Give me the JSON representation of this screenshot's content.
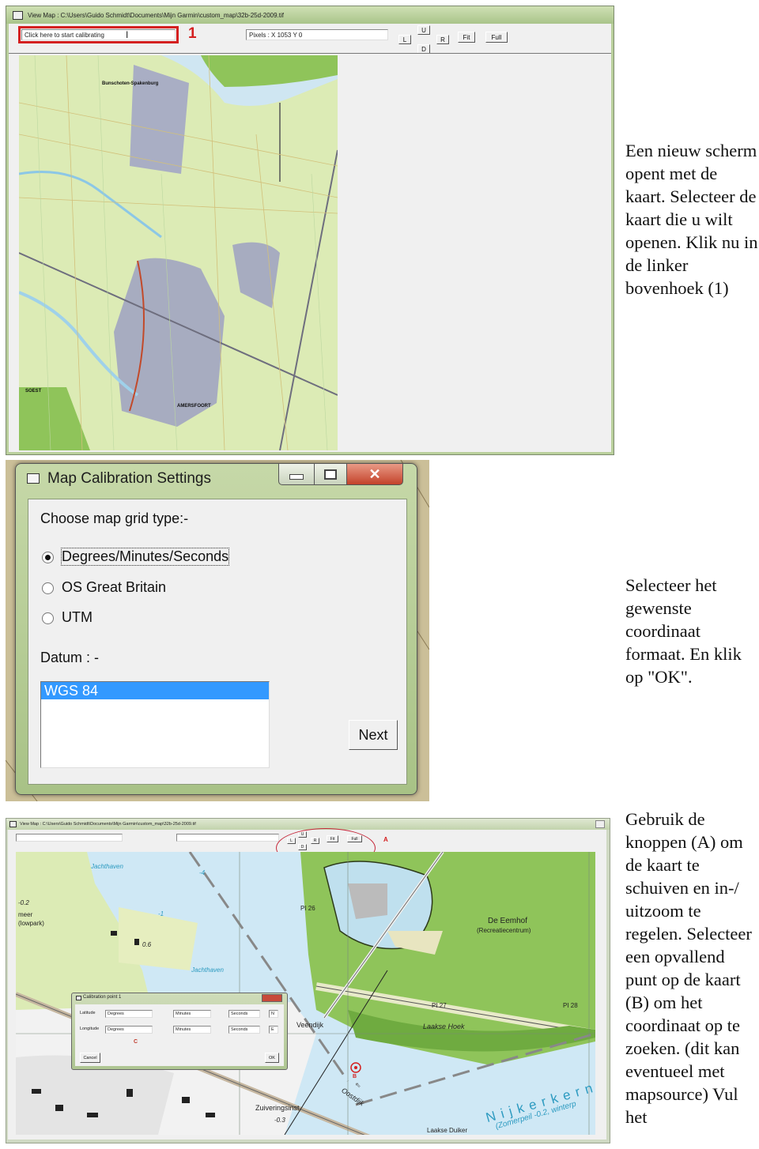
{
  "step1": {
    "window_title": "View Map : C:\\Users\\Guido Schmidt\\Documents\\Mijn Garmin\\custom_map\\32b-25d-2009.tif",
    "calibrate_field_value": "Click here to start calibrating",
    "annotation_marker": "1",
    "pixels_readout": "Pixels : X 1053 Y 0",
    "nav_buttons": {
      "left": "L",
      "up": "U",
      "right": "R",
      "down": "D",
      "fit": "Fit",
      "full": "Full"
    },
    "map_labels": [
      "Bunschoten-Spakenburg",
      "SOEST",
      "AMERSFOORT"
    ],
    "caption": "Een nieuw scherm opent met de kaart. Selecteer de kaart die u wilt openen. Klik nu in de linker bovenhoek (1)"
  },
  "step2": {
    "dialog_title": "Map Calibration Settings",
    "grid_type_label": "Choose map grid type:-",
    "grid_options": [
      {
        "label": "Degrees/Minutes/Seconds",
        "selected": true
      },
      {
        "label": "OS Great Britain",
        "selected": false
      },
      {
        "label": "UTM",
        "selected": false
      }
    ],
    "datum_label": "Datum : -",
    "datum_options": [
      {
        "label": "WGS 84",
        "selected": true
      }
    ],
    "next_button": "Next",
    "caption": "Selecteer het gewenste coordinaat formaat. En klik op \"OK\"."
  },
  "step3": {
    "window_title": "View Map : C:\\Users\\Guido Schmidt\\Documents\\Mijn Garmin\\custom_map\\32b-25d-2009.tif",
    "nav_buttons": {
      "left": "L",
      "up": "U",
      "right": "R",
      "down": "D",
      "fit": "Fit",
      "full": "Full"
    },
    "annotation_a": "A",
    "annotation_b": "B",
    "annotation_c": "C",
    "map_labels": [
      "Jachthaven",
      "-4",
      "-1",
      "0.6",
      "-0.2",
      "meer",
      "(lowpark)",
      "Jachthaven",
      "PI 26",
      "De Eemhof",
      "(Recreatiecentrum)",
      "PI 27",
      "PI 28",
      "Laakse Hoek",
      "Veendijk",
      "Oostdijk",
      "Zuiveringsinst",
      "-0.3",
      "Nijkerkerna",
      "(Zomerpeil -0.2, winterp",
      "Laakse Duiker"
    ],
    "calibration_dialog": {
      "title": "Calibration point 1",
      "latitude_label": "Latitude",
      "longitude_label": "Longitude",
      "lat_degrees": "Degrees",
      "lat_minutes": "Minutes",
      "lat_seconds": "Seconds",
      "lat_hemisphere": "N",
      "lon_degrees": "Degrees",
      "lon_minutes": "Minutes",
      "lon_seconds": "Seconds",
      "lon_hemisphere": "E",
      "cancel_button": "Cancel",
      "ok_button": "OK"
    },
    "caption": "Gebruik de knoppen (A) om de kaart te schuiven en in-/ uitzoom te regelen. Selecteer een opvallend punt op de kaart (B) om het coordinaat op te zoeken. (dit kan eventueel met mapsource) Vul het"
  },
  "colors": {
    "annotation_red": "#d42020",
    "selection_blue": "#3399ff",
    "map_water": "#cfe8f5",
    "map_land": "#dbeab8",
    "map_forest": "#8fc45a"
  }
}
